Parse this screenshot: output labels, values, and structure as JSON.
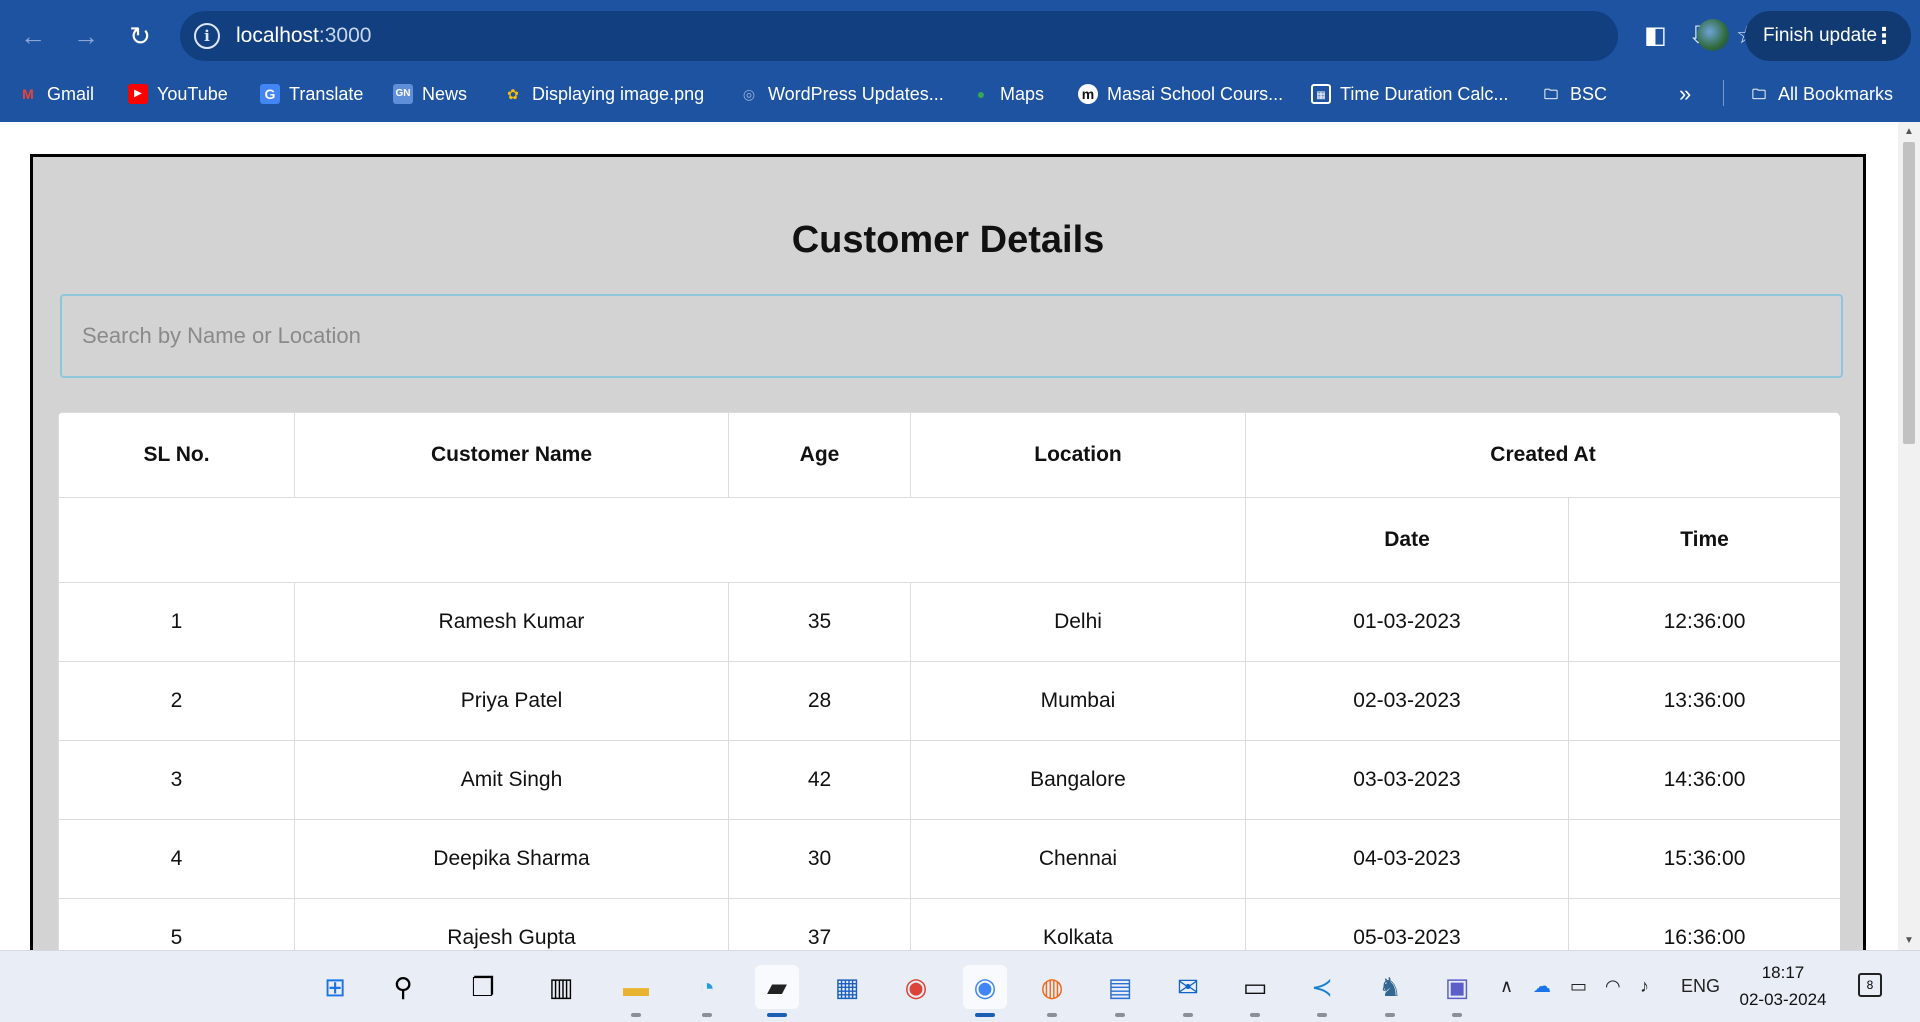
{
  "browser": {
    "url_host": "localhost",
    "url_port": ":3000",
    "finish_update": "Finish update",
    "bookmarks": [
      {
        "label": "Gmail",
        "icon": "gmail-icon"
      },
      {
        "label": "YouTube",
        "icon": "youtube-icon"
      },
      {
        "label": "Translate",
        "icon": "translate-icon"
      },
      {
        "label": "News",
        "icon": "news-icon"
      },
      {
        "label": "Displaying image.png",
        "icon": "photos-icon"
      },
      {
        "label": "WordPress Updates...",
        "icon": "wordpress-icon"
      },
      {
        "label": "Maps",
        "icon": "maps-icon"
      },
      {
        "label": "Masai School Cours...",
        "icon": "masai-icon"
      },
      {
        "label": "Time Duration Calc...",
        "icon": "calculator-icon"
      },
      {
        "label": "BSC",
        "icon": "folder-icon"
      }
    ],
    "more": "»",
    "all_bookmarks": "All Bookmarks"
  },
  "page": {
    "title": "Customer Details",
    "search_placeholder": "Search by Name or Location",
    "headers": {
      "sl": "SL No.",
      "name": "Customer Name",
      "age": "Age",
      "location": "Location",
      "created": "Created At",
      "date": "Date",
      "time": "Time"
    },
    "rows": [
      {
        "sl": "1",
        "name": "Ramesh Kumar",
        "age": "35",
        "location": "Delhi",
        "date": "01-03-2023",
        "time": "12:36:00"
      },
      {
        "sl": "2",
        "name": "Priya Patel",
        "age": "28",
        "location": "Mumbai",
        "date": "02-03-2023",
        "time": "13:36:00"
      },
      {
        "sl": "3",
        "name": "Amit Singh",
        "age": "42",
        "location": "Bangalore",
        "date": "03-03-2023",
        "time": "14:36:00"
      },
      {
        "sl": "4",
        "name": "Deepika Sharma",
        "age": "30",
        "location": "Chennai",
        "date": "04-03-2023",
        "time": "15:36:00"
      },
      {
        "sl": "5",
        "name": "Rajesh Gupta",
        "age": "37",
        "location": "Kolkata",
        "date": "05-03-2023",
        "time": "16:36:00"
      }
    ]
  },
  "taskbar": {
    "language": "ENG",
    "time": "18:17",
    "date": "02-03-2024",
    "notification_count": "8"
  },
  "colors": {
    "chrome_bg": "#1e53a1",
    "container_bg": "#d3d3d3",
    "search_border": "#8fc6dc"
  }
}
